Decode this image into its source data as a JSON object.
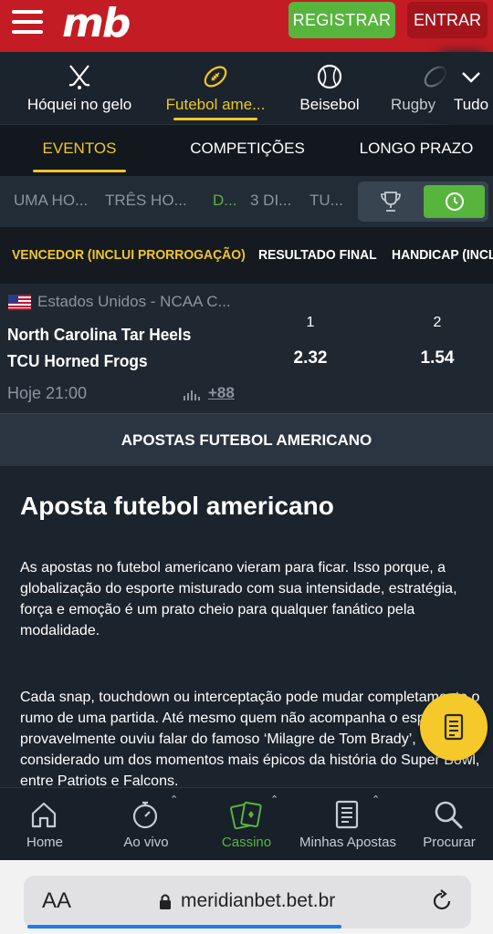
{
  "header": {
    "logo": "mb",
    "register_label": "REGISTRAR",
    "login_label": "ENTRAR",
    "colors": {
      "header_bg": "#c41c24",
      "register_bg": "#57b53d",
      "login_bg": "#a3141b"
    }
  },
  "sports": {
    "items": [
      {
        "label": "Hóquei no gelo",
        "icon": "hockey-sticks-icon"
      },
      {
        "label": "Futebol ame...",
        "icon": "american-football-icon",
        "active": true
      },
      {
        "label": "Beisebol",
        "icon": "baseball-icon"
      },
      {
        "label": "Rugby",
        "icon": "rugby-ball-icon"
      }
    ],
    "all_label": "Tudo"
  },
  "tabs": [
    {
      "label": "EVENTOS",
      "active": true
    },
    {
      "label": "COMPETIÇÕES"
    },
    {
      "label": "LONGO PRAZO"
    }
  ],
  "time_filters": [
    {
      "label": "UMA HO..."
    },
    {
      "label": "TRÊS HO..."
    },
    {
      "label": "D...",
      "active": true
    },
    {
      "label": "3 DI..."
    },
    {
      "label": "TU..."
    }
  ],
  "markets": [
    {
      "label": "VENCEDOR (INCLUI PRORROGAÇÃO)",
      "active": true
    },
    {
      "label": "RESULTADO FINAL"
    },
    {
      "label": "HANDICAP (INCL"
    }
  ],
  "match": {
    "league": "Estados Unidos - NCAA C...",
    "home_team": "North Carolina Tar Heels",
    "away_team": "TCU Horned Frogs",
    "odds_headers": [
      "1",
      "2"
    ],
    "odds": [
      "2.32",
      "1.54"
    ],
    "time": "Hoje 21:00",
    "more_markets": "+88"
  },
  "section": {
    "bar_title": "APOSTAS FUTEBOL AMERICANO",
    "heading": "Aposta futebol americano",
    "paragraph1": "As apostas no futebol americano vieram para ficar. Isso porque, a globalização do esporte misturado com sua intensidade, estratégia, força e emoção é um prato cheio para qualquer fanático pela modalidade.",
    "paragraph2": "Cada snap, touchdown ou interceptação pode mudar completamente o rumo de uma partida. Até mesmo quem não acompanha o esporte provavelmente ouviu falar do famoso ‘Milagre de Tom Brady’, considerado um dos momentos mais épicos da história do Super Bowl, entre Patriots e Falcons."
  },
  "bottom_nav": [
    {
      "label": "Home",
      "icon": "home-icon"
    },
    {
      "label": "Ao vivo",
      "icon": "stopwatch-icon"
    },
    {
      "label": "Cassino",
      "icon": "cards-icon",
      "active": true
    },
    {
      "label": "Minhas Apostas",
      "icon": "betslip-icon"
    },
    {
      "label": "Procurar",
      "icon": "search-icon"
    }
  ],
  "browser": {
    "text_size_label": "AA",
    "url": "meridianbet.bet.br"
  }
}
